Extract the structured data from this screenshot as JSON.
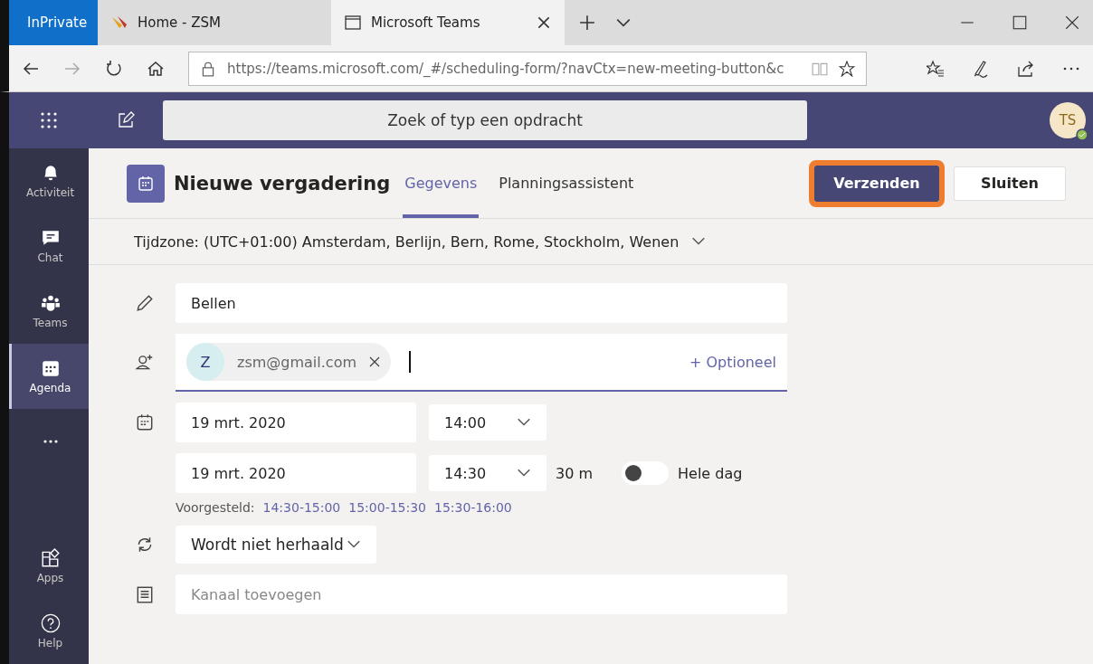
{
  "browser": {
    "private_badge": "InPrivate",
    "tabs": [
      {
        "title": "Home - ZSM",
        "selected": false
      },
      {
        "title": "Microsoft Teams",
        "selected": true
      }
    ],
    "url": "https://teams.microsoft.com/_#/scheduling-form/?navCtx=new-meeting-button&c"
  },
  "header": {
    "search": {
      "placeholder": "Zoek of typ een opdracht"
    },
    "avatar": "TS"
  },
  "rail": [
    {
      "label": "Activiteit",
      "kind": "bell",
      "selected": false
    },
    {
      "label": "Chat",
      "kind": "chat",
      "selected": false
    },
    {
      "label": "Teams",
      "kind": "teams",
      "selected": false
    },
    {
      "label": "Agenda",
      "kind": "calendar",
      "selected": true
    },
    {
      "kind": "more",
      "selected": false
    }
  ],
  "rail_bottom": [
    {
      "label": "Apps",
      "kind": "apps"
    },
    {
      "label": "Help",
      "kind": "help"
    }
  ],
  "title": "Nieuwe vergadering",
  "tabs": [
    {
      "label": "Gegevens",
      "selected": true
    },
    {
      "label": "Planningsassistent",
      "selected": false
    }
  ],
  "actions": [
    {
      "label": "Verzenden",
      "kind": "primary",
      "highlighted": true
    },
    {
      "label": "Sluiten",
      "kind": "secondary",
      "highlighted": false
    }
  ],
  "timezone": "Tijdzone: (UTC+01:00) Amsterdam, Berlijn, Bern, Rome, Stockholm, Wenen",
  "form": {
    "title_value": "Bellen",
    "attendee": {
      "initial": "Z",
      "email": "zsm@gmail.com"
    },
    "optional": "+ Optioneel",
    "start_date": "19 mrt. 2020",
    "start_time": "14:00",
    "end_date": "19 mrt. 2020",
    "end_time": "14:30",
    "duration": "30 m",
    "all_day": {
      "label": "Hele dag",
      "on": false
    },
    "suggested_label": "Voorgesteld:",
    "suggestions": [
      "14:30-15:00",
      "15:00-15:30",
      "15:30-16:00"
    ],
    "repeat": "Wordt niet herhaald",
    "channel": {
      "placeholder": "Kanaal toevoegen"
    }
  }
}
